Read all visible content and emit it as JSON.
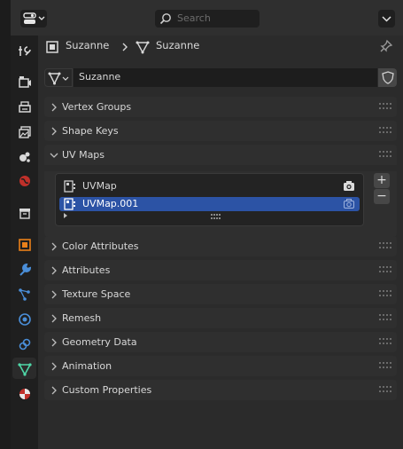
{
  "header": {
    "search_placeholder": "Search"
  },
  "breadcrumb": {
    "object_name": "Suzanne",
    "data_name": "Suzanne"
  },
  "mesh_datablock": {
    "name": "Suzanne"
  },
  "tabs": [
    {
      "name": "tool",
      "icon": "tool-icon"
    },
    {
      "name": "render",
      "icon": "render-icon"
    },
    {
      "name": "output",
      "icon": "output-icon"
    },
    {
      "name": "view-layer",
      "icon": "view-layer-icon"
    },
    {
      "name": "scene",
      "icon": "scene-icon"
    },
    {
      "name": "world",
      "icon": "world-icon"
    },
    {
      "name": "collection",
      "icon": "collection-icon"
    },
    {
      "name": "object",
      "icon": "object-icon"
    },
    {
      "name": "modifiers",
      "icon": "wrench-icon"
    },
    {
      "name": "particles",
      "icon": "particles-icon"
    },
    {
      "name": "physics",
      "icon": "physics-icon"
    },
    {
      "name": "constraints",
      "icon": "constraints-icon"
    },
    {
      "name": "data",
      "icon": "mesh-data-icon",
      "active": true
    },
    {
      "name": "material",
      "icon": "material-icon"
    }
  ],
  "panels": {
    "vertex_groups": "Vertex Groups",
    "shape_keys": "Shape Keys",
    "uv_maps": "UV Maps",
    "color_attributes": "Color Attributes",
    "attributes": "Attributes",
    "texture_space": "Texture Space",
    "remesh": "Remesh",
    "geometry_data": "Geometry Data",
    "animation": "Animation",
    "custom_properties": "Custom Properties"
  },
  "uv_maps": {
    "items": [
      {
        "name": "UVMap",
        "selected": false
      },
      {
        "name": "UVMap.001",
        "selected": true
      }
    ],
    "add_label": "+",
    "remove_label": "−"
  },
  "colors": {
    "selection": "#2c53a5",
    "active_data_tab": "#4fd8a8",
    "panel": "#2f2f2f"
  }
}
